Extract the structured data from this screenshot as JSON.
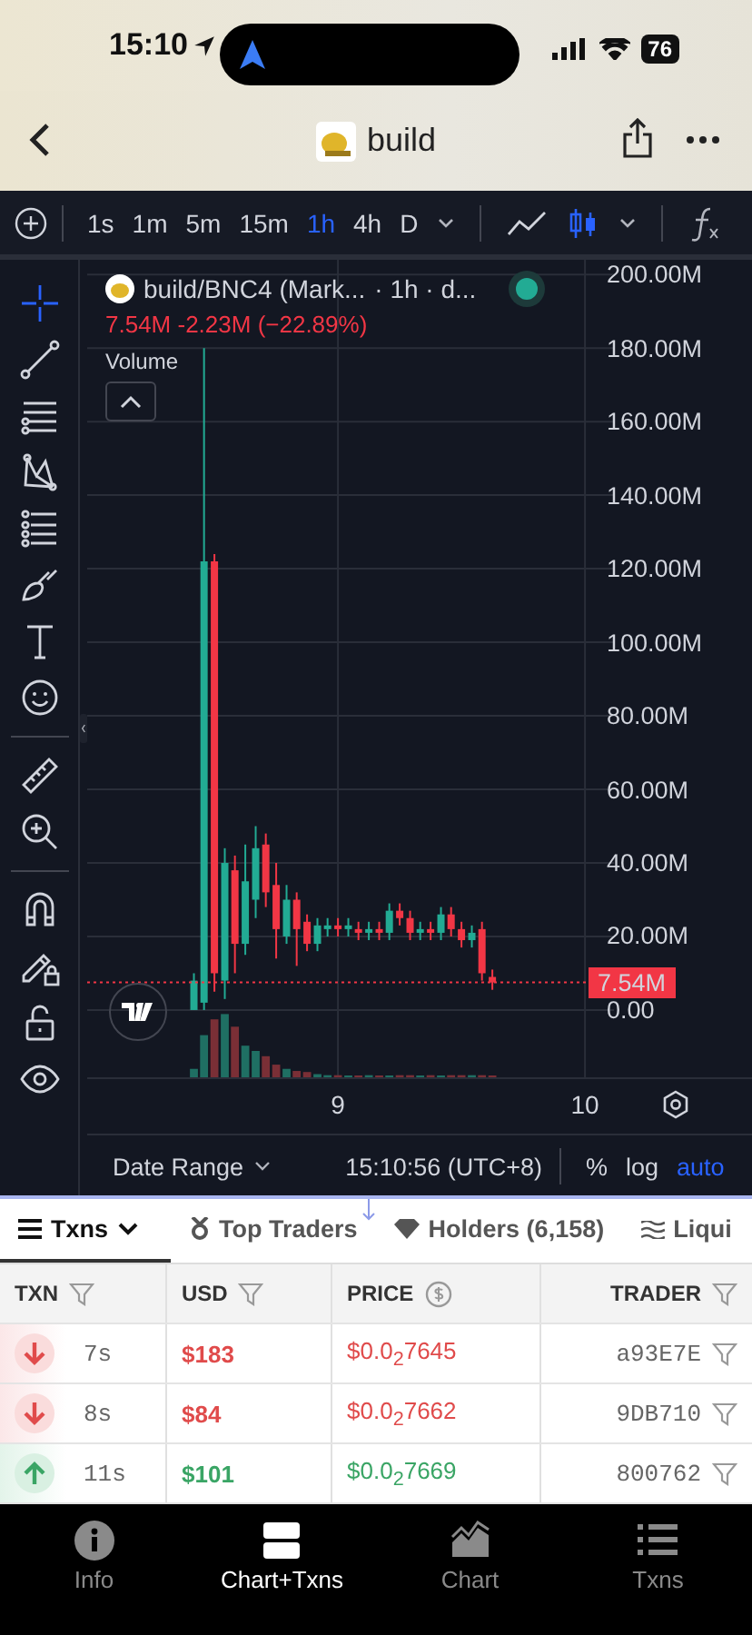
{
  "status_bar": {
    "time": "15:10",
    "battery": "76"
  },
  "nav": {
    "title": "build"
  },
  "toolbar": {
    "intervals": [
      {
        "label": "1s",
        "selected": false
      },
      {
        "label": "1m",
        "selected": false
      },
      {
        "label": "5m",
        "selected": false
      },
      {
        "label": "15m",
        "selected": false
      },
      {
        "label": "1h",
        "selected": true
      },
      {
        "label": "4h",
        "selected": false
      },
      {
        "label": "D",
        "selected": false
      }
    ],
    "chart_types": [
      {
        "kind": "line",
        "selected": false
      },
      {
        "kind": "candles",
        "selected": true
      }
    ]
  },
  "drawing_tools": [
    {
      "kind": "crosshair",
      "selected": true
    },
    {
      "kind": "trend-line",
      "selected": false
    },
    {
      "kind": "lines",
      "selected": false
    },
    {
      "kind": "pattern",
      "selected": false
    },
    {
      "kind": "fib",
      "selected": false
    },
    {
      "kind": "brush",
      "selected": false
    },
    {
      "kind": "text",
      "selected": false
    },
    {
      "kind": "emoji",
      "selected": false
    },
    {
      "kind": "ruler",
      "selected": false
    },
    {
      "kind": "zoom",
      "selected": false
    },
    {
      "kind": "magnet",
      "selected": false
    },
    {
      "kind": "pencil-lock",
      "selected": false
    },
    {
      "kind": "lock",
      "selected": false
    },
    {
      "kind": "eye",
      "selected": false
    }
  ],
  "chart": {
    "symbol": "build/BNC4 (Mark...",
    "interval": "· 1h · d...",
    "change": "7.54M -2.23M (−22.89%)",
    "volume_label": "Volume",
    "chart_data": {
      "type": "candlestick",
      "x": [
        8.417,
        8.458,
        8.5,
        8.542,
        8.583,
        8.625,
        8.667,
        8.708,
        8.75,
        8.792,
        8.833,
        8.875,
        8.917,
        8.958,
        9,
        9.042,
        9.083,
        9.125,
        9.167,
        9.208,
        9.25,
        9.292,
        9.333,
        9.375,
        9.417,
        9.458,
        9.5,
        9.542,
        9.583,
        9.625
      ],
      "ohlc": [
        [
          0,
          10,
          0,
          8
        ],
        [
          2,
          180,
          0,
          122
        ],
        [
          122,
          124,
          5,
          10
        ],
        [
          8,
          44,
          3,
          40
        ],
        [
          38,
          42,
          10,
          18
        ],
        [
          18,
          45,
          15,
          35
        ],
        [
          30,
          50,
          25,
          44
        ],
        [
          45,
          48,
          28,
          32
        ],
        [
          34,
          40,
          14,
          22
        ],
        [
          20,
          34,
          18,
          30
        ],
        [
          30,
          32,
          12,
          22
        ],
        [
          24,
          26,
          16,
          18
        ],
        [
          18,
          25,
          16,
          23
        ],
        [
          22,
          25,
          20,
          23
        ],
        [
          23,
          25,
          20,
          22
        ],
        [
          22,
          25,
          20,
          23
        ],
        [
          22,
          24,
          19,
          21
        ],
        [
          21,
          24,
          19,
          22
        ],
        [
          22,
          24,
          19,
          21
        ],
        [
          21,
          29,
          19,
          27
        ],
        [
          27,
          29,
          23,
          25
        ],
        [
          25,
          27,
          19,
          21
        ],
        [
          21,
          24,
          19,
          22
        ],
        [
          22,
          24,
          19,
          21
        ],
        [
          21,
          28,
          19,
          26
        ],
        [
          26,
          28,
          20,
          22
        ],
        [
          22,
          24,
          17,
          19
        ],
        [
          19,
          23,
          17,
          21
        ],
        [
          22,
          24,
          8,
          10
        ],
        [
          9,
          11,
          5.5,
          7.5
        ]
      ],
      "yticks": [
        {
          "value": 200,
          "label": "200.00M"
        },
        {
          "value": 180,
          "label": "180.00M"
        },
        {
          "value": 160,
          "label": "160.00M"
        },
        {
          "value": 140,
          "label": "140.00M"
        },
        {
          "value": 120,
          "label": "120.00M"
        },
        {
          "value": 100,
          "label": "100.00M"
        },
        {
          "value": 80,
          "label": "80.00M"
        },
        {
          "value": 60,
          "label": "60.00M"
        },
        {
          "value": 40,
          "label": "40.00M"
        },
        {
          "value": 20,
          "label": "20.00M"
        },
        {
          "value": 0,
          "label": "0.00"
        }
      ],
      "xticks": [
        {
          "value": 9,
          "label": "9"
        },
        {
          "value": 10,
          "label": "10"
        }
      ],
      "xlim": [
        7.985,
        10.676
      ],
      "ylim": [
        -33.6,
        204
      ],
      "grid": true,
      "ref_lines": [
        {
          "axis": "y",
          "value": 7.54,
          "color": "#f23645"
        }
      ]
    },
    "last_price": "7.54M",
    "date_range": "Date Range",
    "clock": "15:10:56 (UTC+8)",
    "toggles": [
      {
        "label": "%",
        "selected": false
      },
      {
        "label": "log",
        "selected": false
      },
      {
        "label": "auto",
        "selected": true
      }
    ]
  },
  "tabs": [
    {
      "label": "Txns",
      "selected": true,
      "kind": "menu"
    },
    {
      "label": "Top Traders",
      "selected": false,
      "kind": "traders"
    },
    {
      "label": "Holders (6,158)",
      "selected": false,
      "kind": "holders"
    },
    {
      "label": "Liqui",
      "selected": false,
      "kind": "liquidity"
    }
  ],
  "table": {
    "columns": [
      {
        "label": "TXN",
        "kind": "filter"
      },
      {
        "label": "USD",
        "kind": "filter"
      },
      {
        "label": "PRICE",
        "kind": "currency"
      },
      {
        "label": "TRADER",
        "kind": "filter"
      }
    ],
    "rows": [
      {
        "kind": "sell",
        "age": "7s",
        "usd": "$183",
        "price": "$0.0$_{2}$7645",
        "trader": "a93E7E"
      },
      {
        "kind": "sell",
        "age": "8s",
        "usd": "$84",
        "price": "$0.0$_{2}$7662",
        "trader": "9DB710"
      },
      {
        "kind": "buy",
        "age": "11s",
        "usd": "$101",
        "price": "$0.0$_{2}$7669",
        "trader": "800762"
      }
    ]
  },
  "bottom_nav": [
    {
      "label": "Info",
      "kind": "info",
      "selected": false
    },
    {
      "label": "Chart+Txns",
      "kind": "split",
      "selected": true
    },
    {
      "label": "Chart",
      "kind": "chart",
      "selected": false
    },
    {
      "label": "Txns",
      "kind": "list",
      "selected": false
    }
  ]
}
